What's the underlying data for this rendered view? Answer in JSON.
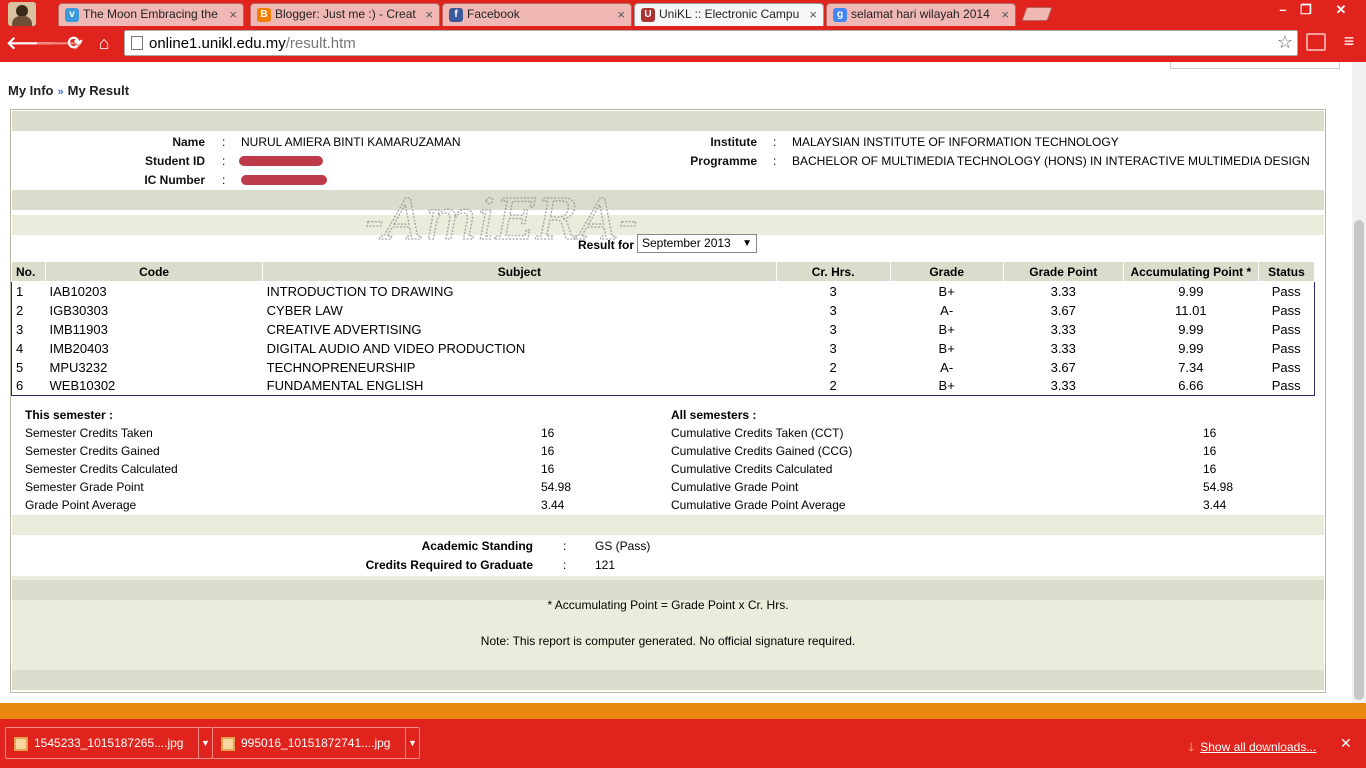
{
  "browser": {
    "tabs": [
      {
        "title": "The Moon Embracing the",
        "favicon": "vimeo-icon",
        "fav_color": "#3a9ad9",
        "fav_text": "v"
      },
      {
        "title": "Blogger: Just me :) - Creat",
        "favicon": "blogger-icon",
        "fav_color": "#f57d00",
        "fav_text": "B"
      },
      {
        "title": "Facebook",
        "favicon": "facebook-icon",
        "fav_color": "#3b5998",
        "fav_text": "f"
      },
      {
        "title": "UniKL :: Electronic Campu",
        "favicon": "unikl-icon",
        "fav_color": "#a33",
        "fav_text": "U"
      },
      {
        "title": "selamat hari wilayah 2014",
        "favicon": "google-icon",
        "fav_color": "#4285f4",
        "fav_text": "g"
      }
    ],
    "url_host": "online1.unikl.edu.my",
    "url_path": "/result.htm",
    "window_controls": {
      "minimize": "–",
      "restore": "❐",
      "close": "✕"
    },
    "nav": {
      "back": "🡐",
      "forward": "🡒",
      "reload": "⟳",
      "home": "⌂"
    }
  },
  "breadcrumb": {
    "first": "My Info",
    "separator": "»",
    "second": "My Result"
  },
  "student": {
    "name_label": "Name",
    "name": "NURUL AMIERA BINTI KAMARUZAMAN",
    "id_label": "Student ID",
    "ic_label": "IC Number",
    "institute_label": "Institute",
    "institute": "MALAYSIAN INSTITUTE OF INFORMATION TECHNOLOGY",
    "programme_label": "Programme",
    "programme": "BACHELOR OF MULTIMEDIA TECHNOLOGY (HONS) IN INTERACTIVE MULTIMEDIA DESIGN",
    "colon": ":"
  },
  "watermark_text": "-AmiERA-",
  "result_for": {
    "label": "Result for",
    "selected": "September 2013",
    "arrow": "▼"
  },
  "table": {
    "headers": [
      "No.",
      "Code",
      "Subject",
      "Cr. Hrs.",
      "Grade",
      "Grade Point",
      "Accumulating Point *",
      "Status"
    ],
    "rows": [
      [
        "1",
        "IAB10203",
        "INTRODUCTION TO DRAWING",
        "3",
        "B+",
        "3.33",
        "9.99",
        "Pass"
      ],
      [
        "2",
        "IGB30303",
        "CYBER LAW",
        "3",
        "A-",
        "3.67",
        "11.01",
        "Pass"
      ],
      [
        "3",
        "IMB11903",
        "CREATIVE ADVERTISING",
        "3",
        "B+",
        "3.33",
        "9.99",
        "Pass"
      ],
      [
        "4",
        "IMB20403",
        "DIGITAL AUDIO AND VIDEO PRODUCTION",
        "3",
        "B+",
        "3.33",
        "9.99",
        "Pass"
      ],
      [
        "5",
        "MPU3232",
        "TECHNOPRENEURSHIP",
        "2",
        "A-",
        "3.67",
        "7.34",
        "Pass"
      ],
      [
        "6",
        "WEB10302",
        "FUNDAMENTAL ENGLISH",
        "2",
        "B+",
        "3.33",
        "6.66",
        "Pass"
      ]
    ]
  },
  "this_semester": {
    "heading": "This semester :",
    "items": [
      {
        "label": "Semester Credits Taken",
        "value": "16"
      },
      {
        "label": "Semester Credits Gained",
        "value": "16"
      },
      {
        "label": "Semester Credits Calculated",
        "value": "16"
      },
      {
        "label": "Semester Grade Point",
        "value": "54.98"
      },
      {
        "label": "Grade Point Average",
        "value": "3.44"
      }
    ]
  },
  "all_semesters": {
    "heading": "All semesters :",
    "items": [
      {
        "label": "Cumulative Credits Taken (CCT)",
        "value": "16"
      },
      {
        "label": "Cumulative Credits Gained (CCG)",
        "value": "16"
      },
      {
        "label": "Cumulative Credits Calculated",
        "value": "16"
      },
      {
        "label": "Cumulative Grade Point",
        "value": "54.98"
      },
      {
        "label": "Cumulative Grade Point Average",
        "value": "3.44"
      }
    ]
  },
  "standing": {
    "academic_label": "Academic Standing",
    "academic_value": "GS (Pass)",
    "credits_label": "Credits Required to Graduate",
    "credits_value": "121",
    "colon": ":"
  },
  "notes": {
    "formula": "* Accumulating Point = Grade Point x Cr. Hrs.",
    "computer_generated": "Note: This report is computer generated. No official signature required."
  },
  "downloads": {
    "items": [
      "1545233_1015187265....jpg",
      "995016_10151872741....jpg"
    ],
    "show_all": "Show all downloads...",
    "close": "✕",
    "drop": "▼",
    "arrow": "🡓"
  },
  "colors": {
    "chrome": "#e0231c",
    "shelf_top": "#e8870f",
    "band": "#dcdccc",
    "table_border": "#2b2b6b"
  }
}
